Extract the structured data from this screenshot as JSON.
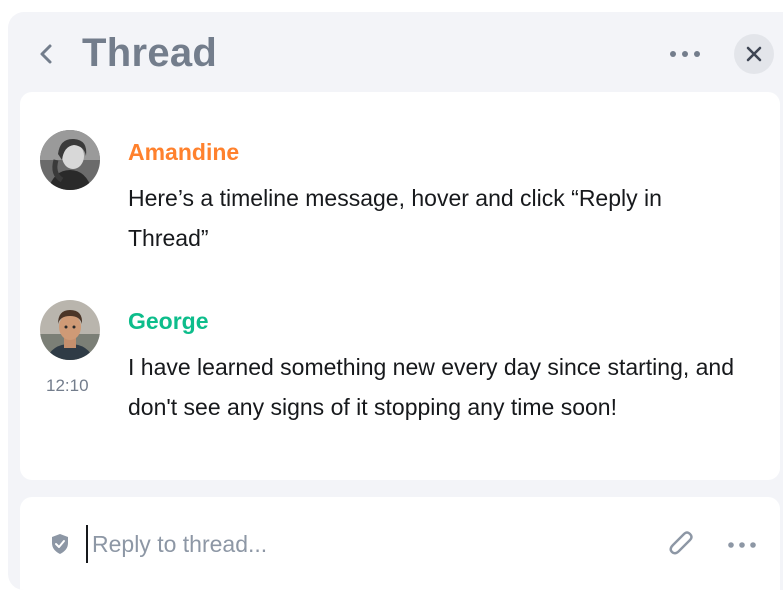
{
  "header": {
    "title": "Thread",
    "back_icon": "chevron-left-icon",
    "more_icon": "ellipsis-icon",
    "close_icon": "close-icon"
  },
  "messages": [
    {
      "sender": "Amandine",
      "sender_color": "#ff812d",
      "body": "Here’s a timeline message, hover and click “Reply in Thread”",
      "avatar_icon": "avatar-amandine",
      "timestamp": ""
    },
    {
      "sender": "George",
      "sender_color": "#0dbd8b",
      "body": "I have learned something new every day since starting, and don't see any signs of it stopping any time soon!",
      "avatar_icon": "avatar-george",
      "timestamp": "12:10"
    }
  ],
  "composer": {
    "placeholder": "Reply to thread...",
    "value": "",
    "shield_icon": "shield-icon",
    "attach_icon": "paperclip-icon",
    "more_icon": "ellipsis-icon"
  }
}
